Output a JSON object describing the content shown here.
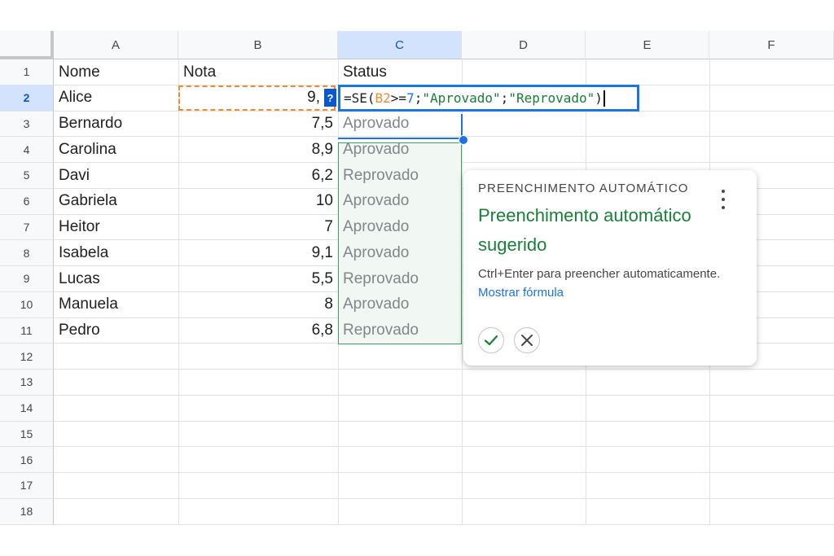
{
  "columns": [
    "A",
    "B",
    "C",
    "D",
    "E",
    "F"
  ],
  "rows": [
    "1",
    "2",
    "3",
    "4",
    "5",
    "6",
    "7",
    "8",
    "9",
    "10",
    "11",
    "12",
    "13",
    "14",
    "15",
    "16",
    "17",
    "18"
  ],
  "headers": {
    "a": "Nome",
    "b": "Nota",
    "c": "Status"
  },
  "data": [
    {
      "name": "Alice",
      "grade": "9,",
      "status": ""
    },
    {
      "name": "Bernardo",
      "grade": "7,5",
      "status": "Aprovado"
    },
    {
      "name": "Carolina",
      "grade": "8,9",
      "status": "Aprovado"
    },
    {
      "name": "Davi",
      "grade": "6,2",
      "status": "Reprovado"
    },
    {
      "name": "Gabriela",
      "grade": "10",
      "status": "Aprovado"
    },
    {
      "name": "Heitor",
      "grade": "7",
      "status": "Aprovado"
    },
    {
      "name": "Isabela",
      "grade": "9,1",
      "status": "Aprovado"
    },
    {
      "name": "Lucas",
      "grade": "5,5",
      "status": "Reprovado"
    },
    {
      "name": "Manuela",
      "grade": "8",
      "status": "Aprovado"
    },
    {
      "name": "Pedro",
      "grade": "6,8",
      "status": "Reprovado"
    }
  ],
  "editor": {
    "p1": "=SE(",
    "ref": "B2",
    "p2": ">=",
    "num": "7",
    "p3": ";",
    "s1": "\"Aprovado\"",
    "p4": ";",
    "s2": "\"Reprovado\"",
    "p5": ")"
  },
  "ref_hint": "?",
  "popup": {
    "kicker": "PREENCHIMENTO AUTOMÁTICO",
    "title": "Preenchimento automático sugerido",
    "desc": "Ctrl+Enter para preencher automaticamente.",
    "link": "Mostrar fórmula"
  },
  "icons": {
    "menu": "more-vert-icon",
    "accept": "check-icon",
    "reject": "close-icon"
  },
  "colors": {
    "selection": "#1a73e8",
    "suggestion_border": "#34a853",
    "title_green": "#188038",
    "reference_orange": "#f28b30"
  }
}
